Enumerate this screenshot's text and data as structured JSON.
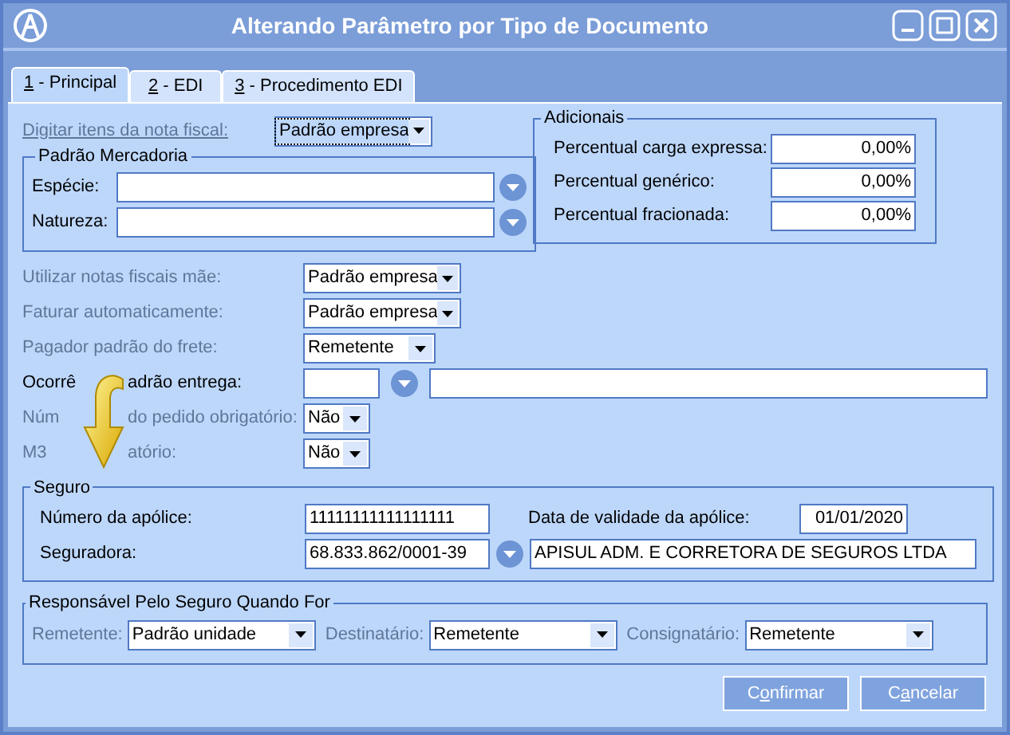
{
  "window": {
    "title": "Alterando Parâmetro por Tipo de Documento"
  },
  "tabs": [
    {
      "key": "1",
      "rest": " - Principal",
      "selected": true
    },
    {
      "key": "2",
      "rest": " - EDI",
      "selected": false
    },
    {
      "key": "3",
      "rest": " - Procedimento EDI",
      "selected": false
    }
  ],
  "nota_fiscal": {
    "label": "Digitar itens da nota fiscal:",
    "disabled": true,
    "value": "Padrão empresa",
    "focused": true
  },
  "padrao_mercadoria": {
    "title": "Padrão Mercadoria",
    "fields": [
      {
        "label": "Espécie:"
      },
      {
        "label": "Natureza:"
      }
    ]
  },
  "adicionais": {
    "title": "Adicionais",
    "fields": [
      {
        "label": "Percentual carga expressa:",
        "value": "0,00%"
      },
      {
        "label": "Percentual genérico:",
        "value": "0,00%"
      },
      {
        "label": "Percentual fracionada:",
        "value": "0,00%"
      }
    ]
  },
  "rows": [
    {
      "kind": "select",
      "label_parts": [
        "Utilizar notas fiscais mãe:"
      ],
      "disabled": true,
      "value": "Padrão empresa"
    },
    {
      "kind": "select",
      "label_parts": [
        "Faturar automaticamente:"
      ],
      "disabled": true,
      "value": "Padrão empresa"
    },
    {
      "kind": "select",
      "label_parts": [
        "Pagador padrão do frete:"
      ],
      "disabled": true,
      "value": "Remetente"
    },
    {
      "kind": "lookup",
      "label_parts": [
        "Ocorrê",
        "adrão entrega:"
      ],
      "disabled": false
    },
    {
      "kind": "select",
      "label_parts": [
        "Núm",
        "do pedido obrigatório:"
      ],
      "disabled": true,
      "value": "Não"
    },
    {
      "kind": "select",
      "label_parts": [
        "M3",
        "atório:"
      ],
      "disabled": true,
      "value": "Não"
    }
  ],
  "seguro": {
    "title": "Seguro",
    "policy_label": "Número da apólice:",
    "policy_value": "11111111111111111",
    "validity_label": "Data de validade da apólice:",
    "validity_value": "01/01/2020",
    "insurer_label": "Seguradora:",
    "insurer_code": "68.833.862/0001-39",
    "insurer_name": "APISUL ADM. E CORRETORA DE SEGUROS LTDA"
  },
  "responsavel": {
    "title": "Responsável Pelo Seguro Quando For",
    "items": [
      {
        "label": "Remetente:",
        "disabled": true,
        "value": "Padrão unidade"
      },
      {
        "label": "Destinatário:",
        "disabled": true,
        "value": "Remetente"
      },
      {
        "label": "Consignatário:",
        "disabled": true,
        "value": "Remetente"
      }
    ]
  },
  "buttons": [
    {
      "before": "C",
      "key": "o",
      "after": "nfirmar"
    },
    {
      "before": "C",
      "key": "a",
      "after": "ncelar"
    }
  ]
}
